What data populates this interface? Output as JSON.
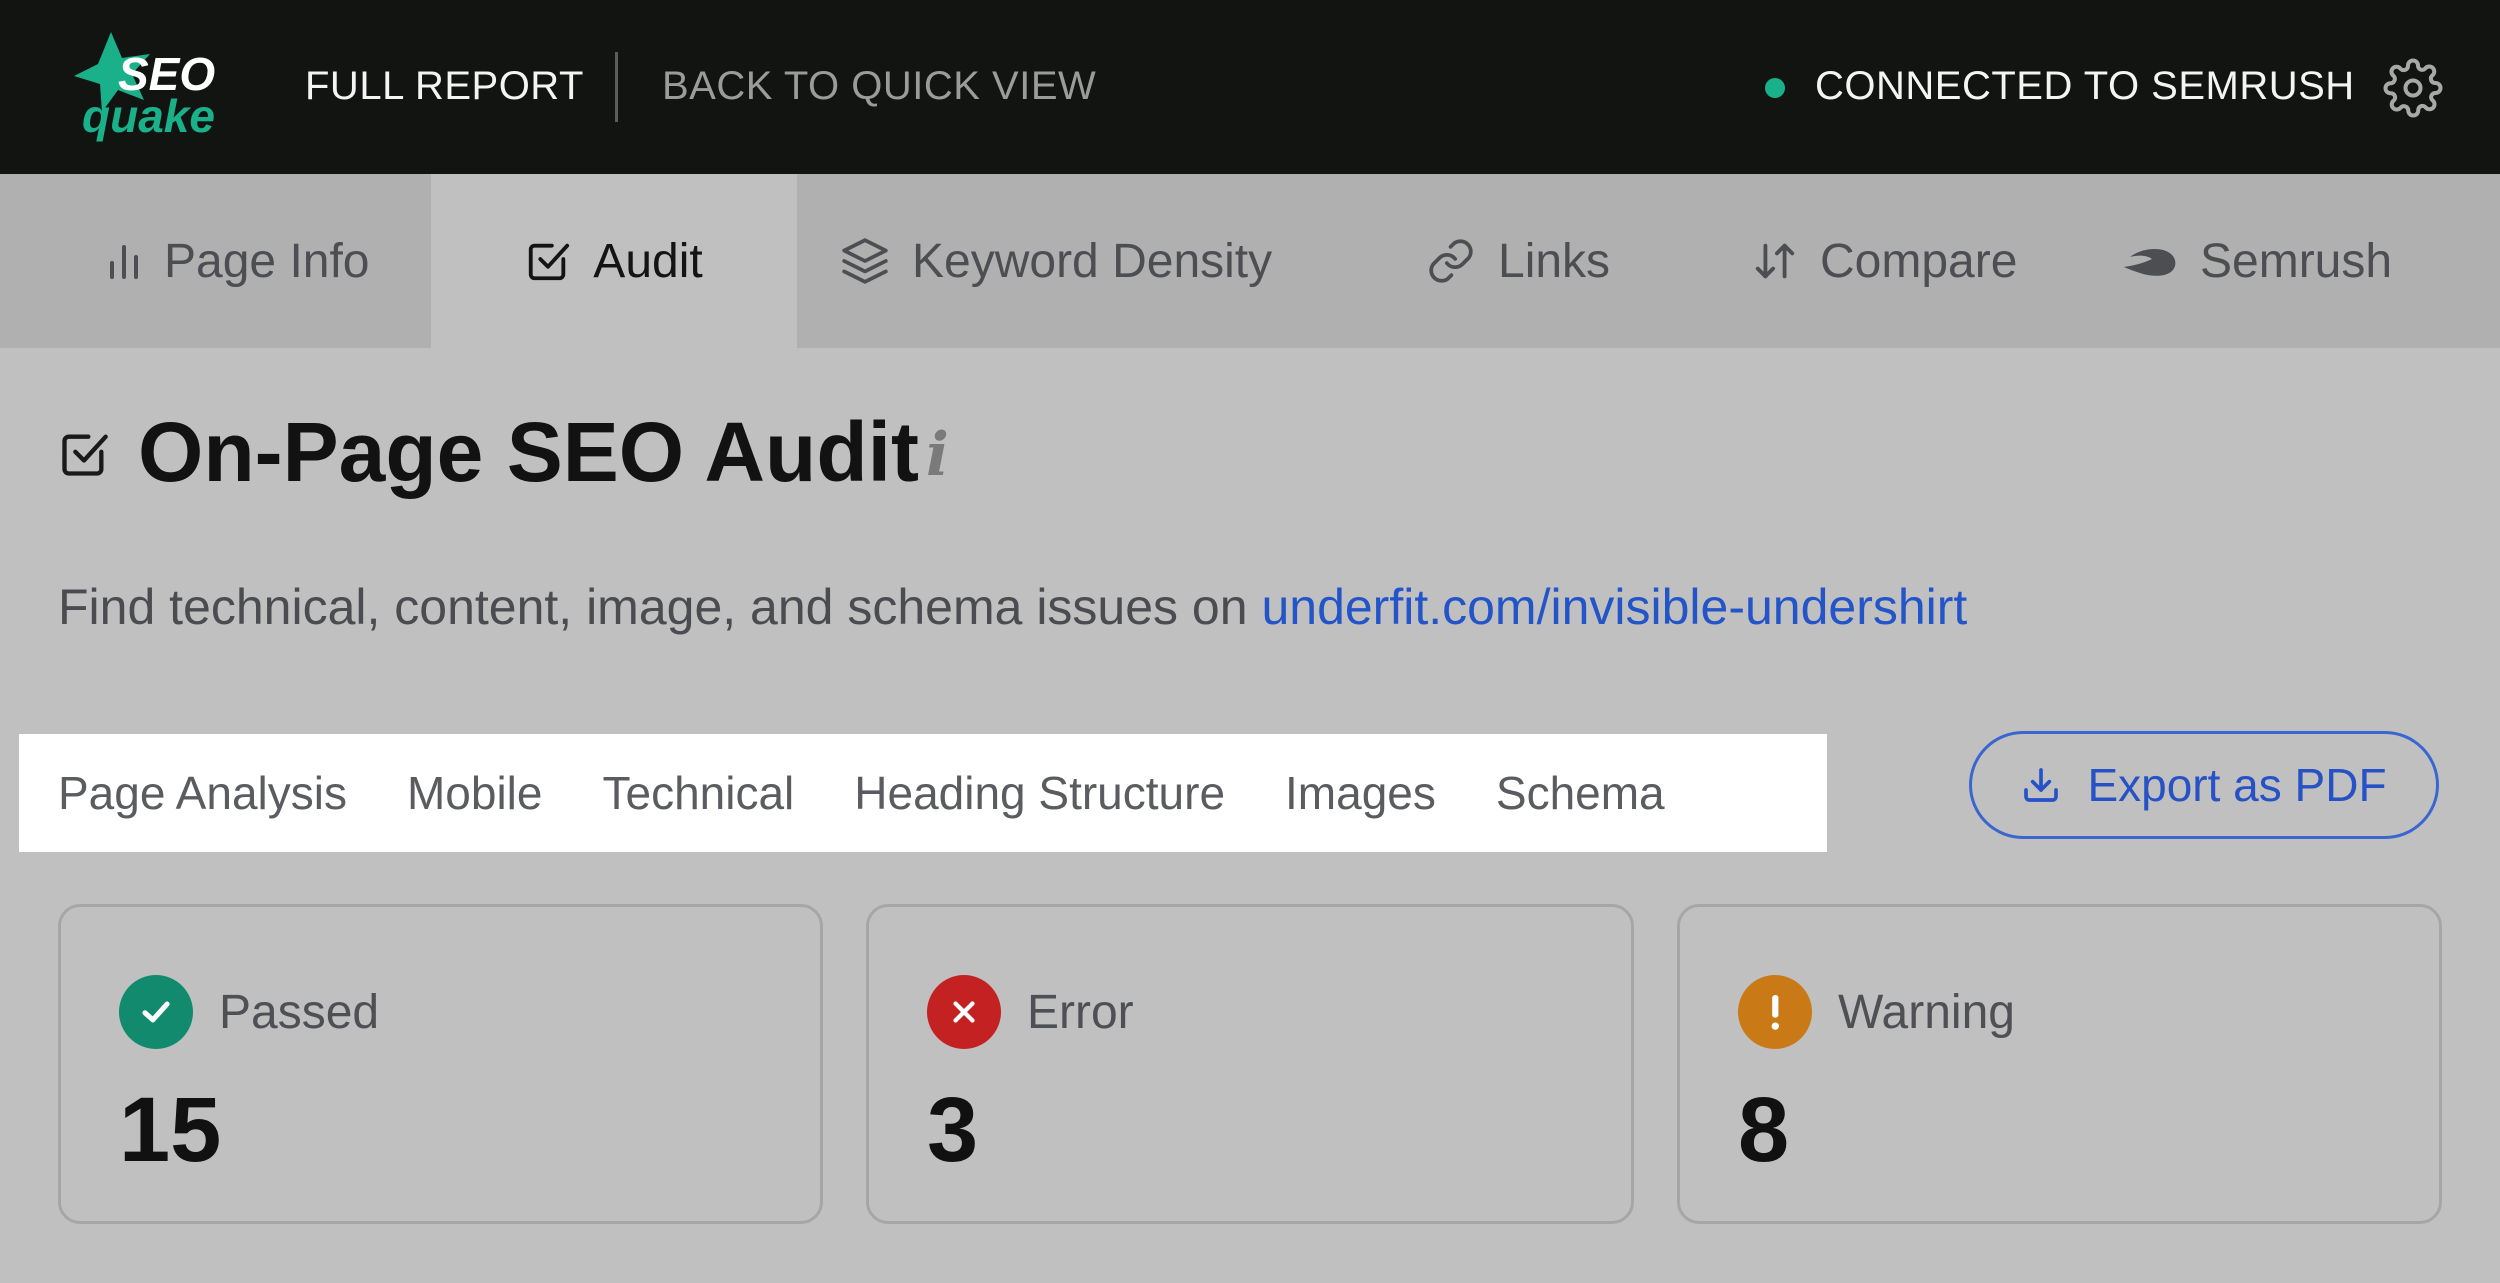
{
  "header": {
    "logo_text_top": "SEO",
    "logo_text_bottom": "quake",
    "full_report": "FULL REPORT",
    "back_to_quick_view": "BACK TO QUICK VIEW",
    "connection_status": "CONNECTED TO SEMRUSH",
    "status_color": "#1ab08a"
  },
  "tabs": [
    {
      "label": "Page Info",
      "icon": "bar-chart-icon",
      "active": false
    },
    {
      "label": "Audit",
      "icon": "checkbox-icon",
      "active": true
    },
    {
      "label": "Keyword Density",
      "icon": "layers-icon",
      "active": false
    },
    {
      "label": "Links",
      "icon": "link-icon",
      "active": false
    },
    {
      "label": "Compare",
      "icon": "sort-arrows-icon",
      "active": false
    },
    {
      "label": "Semrush",
      "icon": "semrush-icon",
      "active": false
    }
  ],
  "main": {
    "title": "On-Page SEO Audit",
    "info_glyph": "i",
    "subtitle_prefix": "Find technical, content, image, and schema issues on ",
    "subtitle_url": "underfit.com/invisible-undershirt",
    "subtabs": [
      "Page Analysis",
      "Mobile",
      "Technical",
      "Heading Structure",
      "Images",
      "Schema"
    ],
    "export_label": "Export as PDF",
    "accent_color": "#2652c6"
  },
  "summary": [
    {
      "label": "Passed",
      "value": "15",
      "icon": "check-circle-icon",
      "color": "#118a6d"
    },
    {
      "label": "Error",
      "value": "3",
      "icon": "x-circle-icon",
      "color": "#c42222"
    },
    {
      "label": "Warning",
      "value": "8",
      "icon": "exclamation-circle-icon",
      "color": "#c97a16"
    }
  ]
}
